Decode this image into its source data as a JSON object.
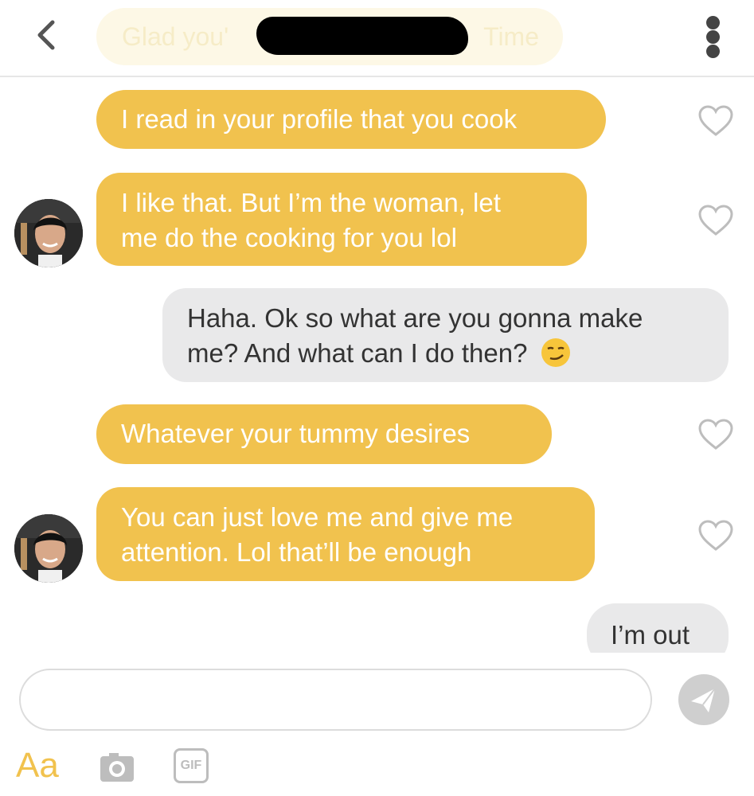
{
  "header": {
    "title_start": "Glad you'",
    "title_end": "Time",
    "back_icon": "chevron-left-icon",
    "more_icon": "more-vertical-icon"
  },
  "messages": [
    {
      "side": "incoming",
      "lines": [
        "I read in your profile that you cook"
      ],
      "avatar": false
    },
    {
      "side": "incoming",
      "lines": [
        "I like that. But I’m the woman, let",
        "me do the cooking for you lol"
      ],
      "avatar": true
    },
    {
      "side": "outgoing",
      "lines": [
        "Haha. Ok so what are you gonna make",
        "me? And what can I do then?"
      ],
      "emoji": "smirking-face-emoji"
    },
    {
      "side": "incoming",
      "lines": [
        "Whatever your tummy desires"
      ],
      "avatar": false
    },
    {
      "side": "incoming",
      "lines": [
        "You can just love me and give me",
        "attention. Lol that’ll be enough"
      ],
      "avatar": true
    },
    {
      "side": "outgoing",
      "lines": [
        "I’m out"
      ]
    }
  ],
  "composer": {
    "placeholder": "",
    "send_icon": "send-icon",
    "text_format_label": "Aa",
    "camera_icon": "camera-icon",
    "gif_label": "GIF"
  },
  "colors": {
    "incoming_bubble": "#f1c24e",
    "outgoing_bubble": "#e9e9ea",
    "accent": "#f1c24e"
  }
}
